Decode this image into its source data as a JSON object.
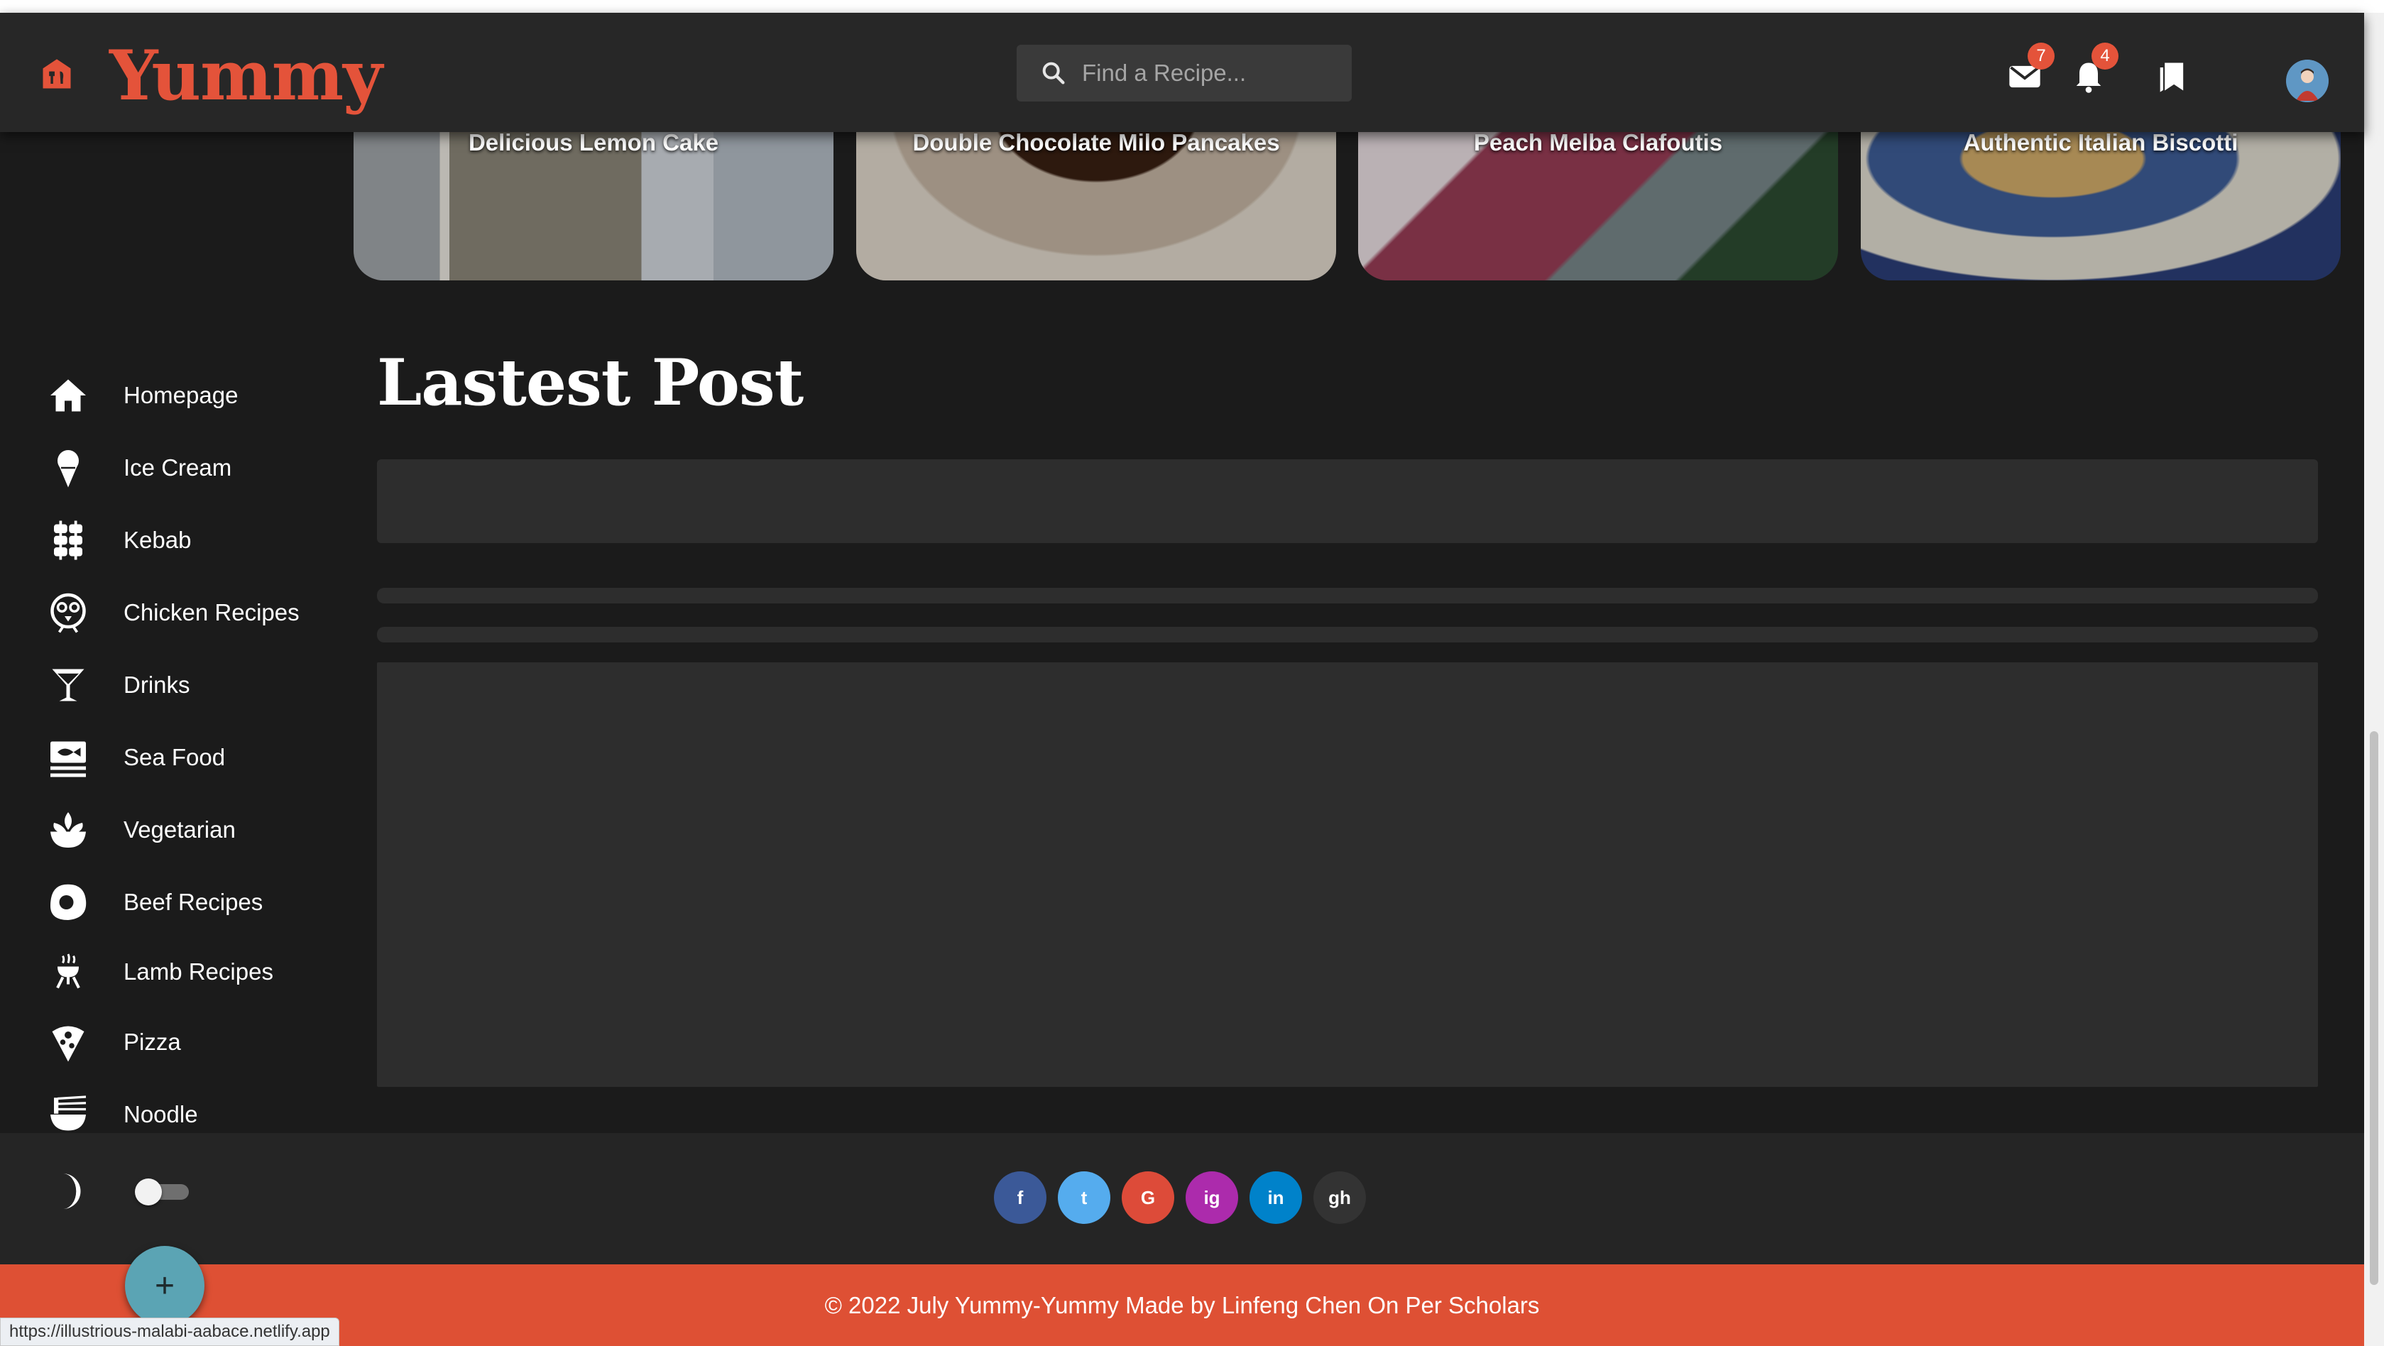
{
  "app": {
    "name": "Yummy"
  },
  "header": {
    "search_placeholder": "Find a Recipe...",
    "mail_count": "7",
    "notification_count": "4"
  },
  "featured_cards": [
    {
      "title": "Delicious Lemon Cake"
    },
    {
      "title": "Double Chocolate Milo Pancakes"
    },
    {
      "title": "Peach Melba Clafoutis"
    },
    {
      "title": "Authentic Italian Biscotti"
    }
  ],
  "sidebar": {
    "items": [
      {
        "label": "Homepage",
        "icon": "home-icon"
      },
      {
        "label": "Ice Cream",
        "icon": "ice-cream-icon"
      },
      {
        "label": "Kebab",
        "icon": "kebab-icon"
      },
      {
        "label": "Chicken Recipes",
        "icon": "chicken-icon"
      },
      {
        "label": "Drinks",
        "icon": "cocktail-icon"
      },
      {
        "label": "Sea Food",
        "icon": "fish-icon"
      },
      {
        "label": "Vegetarian",
        "icon": "leaf-bowl-icon"
      },
      {
        "label": "Beef Recipes",
        "icon": "steak-icon"
      },
      {
        "label": "Lamb Recipes",
        "icon": "grill-icon"
      },
      {
        "label": "Pizza",
        "icon": "pizza-icon"
      },
      {
        "label": "Noodle",
        "icon": "noodle-icon"
      }
    ]
  },
  "main": {
    "section_title": "Lastest Post"
  },
  "footer": {
    "social": [
      {
        "label": "f",
        "icon": "facebook-icon",
        "color": "#3b5998"
      },
      {
        "label": "t",
        "icon": "twitter-icon",
        "color": "#55acee"
      },
      {
        "label": "G",
        "icon": "google-icon",
        "color": "#dd4b39"
      },
      {
        "label": "ig",
        "icon": "instagram-icon",
        "color": "#ac2bac"
      },
      {
        "label": "in",
        "icon": "linkedin-icon",
        "color": "#0082ca"
      },
      {
        "label": "gh",
        "icon": "github-icon",
        "color": "#333333"
      }
    ],
    "copyright": "© 2022 July Yummy-Yummy Made by Linfeng Chen On Per Scholars"
  },
  "fab_label": "+",
  "status_url": "https://illustrious-malabi-aabace.netlify.app",
  "colors": {
    "brand": "#e4533a",
    "background": "#1b1b1b",
    "header": "#272727",
    "fab": "#5ba4b4"
  }
}
